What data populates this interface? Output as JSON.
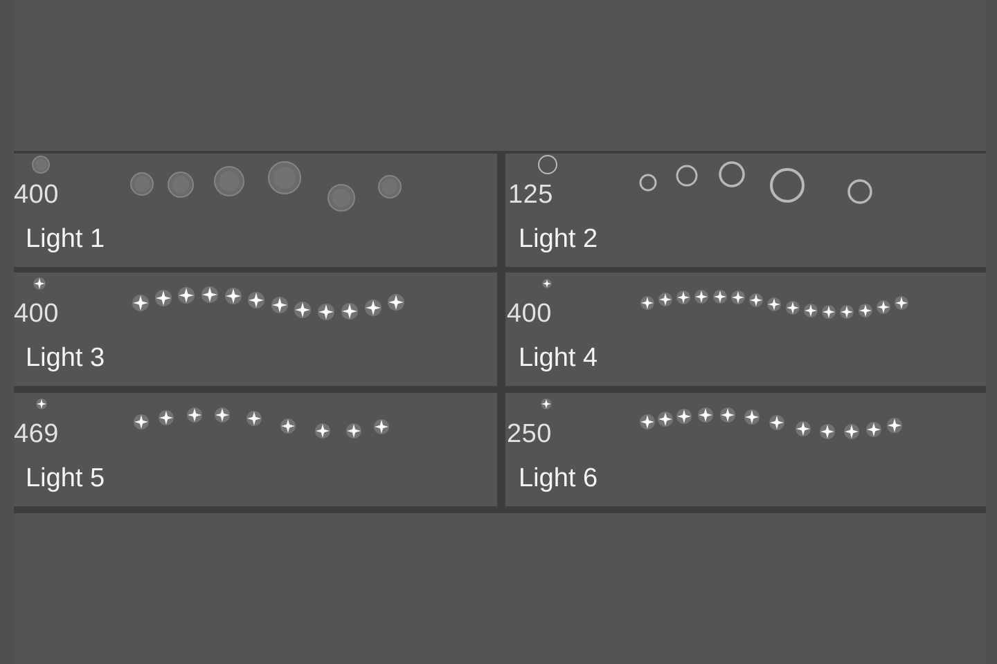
{
  "panel": {
    "colors": {
      "background": "#545454",
      "divider": "#3d3d3d",
      "text_size": "#e2e2e2",
      "text_name": "#f4f4f4",
      "mark": "#ffffff"
    },
    "brushes": [
      {
        "size": "400",
        "name": "Light 1",
        "tip_icon": "soft-circle-icon",
        "stroke_style": "soft-bokeh"
      },
      {
        "size": "125",
        "name": "Light 2",
        "tip_icon": "ring-icon",
        "stroke_style": "rings"
      },
      {
        "size": "400",
        "name": "Light 3",
        "tip_icon": "sparkle-icon",
        "stroke_style": "sparkles"
      },
      {
        "size": "400",
        "name": "Light 4",
        "tip_icon": "sparkle-icon",
        "stroke_style": "sparkles-dense"
      },
      {
        "size": "469",
        "name": "Light 5",
        "tip_icon": "sparkle-icon",
        "stroke_style": "sparkles-sparse"
      },
      {
        "size": "250",
        "name": "Light 6",
        "tip_icon": "sparkle-icon",
        "stroke_style": "sparkles-wave"
      }
    ]
  }
}
